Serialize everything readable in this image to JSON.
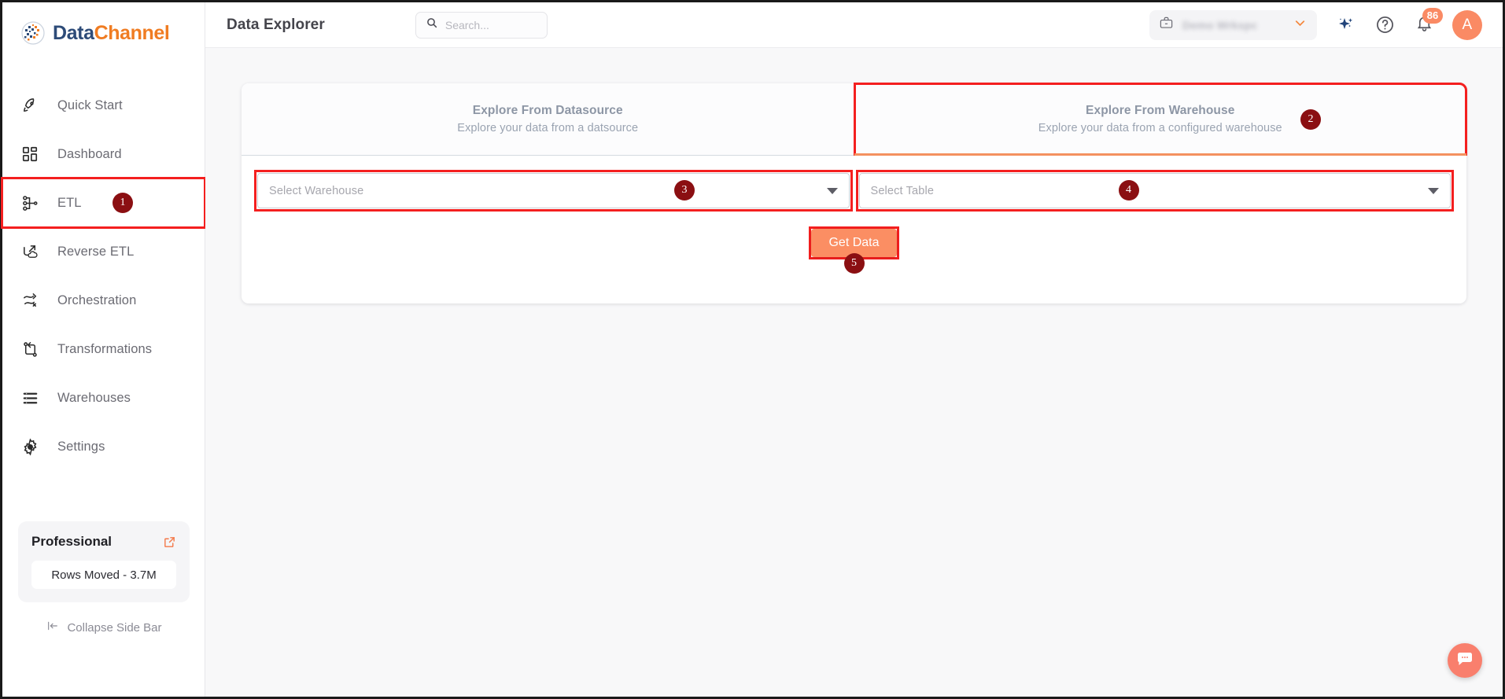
{
  "brand": {
    "name_part1": "Data",
    "name_part2": "Channel",
    "logo_icon": "datachannel-globe-logo",
    "color_primary": "#2d4b78",
    "color_accent": "#f07c22"
  },
  "sidebar": {
    "items": [
      {
        "label": "Quick Start",
        "icon": "rocket-icon"
      },
      {
        "label": "Dashboard",
        "icon": "dashboard-grid-icon"
      },
      {
        "label": "ETL",
        "icon": "etl-nodes-icon"
      },
      {
        "label": "Reverse ETL",
        "icon": "reverse-etl-cloud-icon"
      },
      {
        "label": "Orchestration",
        "icon": "orchestration-path-icon"
      },
      {
        "label": "Transformations",
        "icon": "transformations-branch-icon"
      },
      {
        "label": "Warehouses",
        "icon": "warehouse-stack-icon"
      },
      {
        "label": "Settings",
        "icon": "gear-icon"
      }
    ],
    "plan": {
      "name": "Professional",
      "external_link_icon": "external-link-icon",
      "usage_label": "Rows Moved - 3.7M"
    },
    "collapse": {
      "label": "Collapse Side Bar",
      "icon": "collapse-left-icon"
    }
  },
  "header": {
    "title": "Data Explorer",
    "search": {
      "placeholder": "Search...",
      "value": "",
      "icon": "search-icon"
    },
    "workspace": {
      "icon": "briefcase-icon",
      "name": "Demo Wrkspc",
      "chevron": "chevron-down-icon"
    },
    "ai_icon": "sparkle-ai-icon",
    "help_icon": "help-circle-icon",
    "notifications": {
      "icon": "bell-icon",
      "count": "86",
      "badge_color": "#fa8a64"
    },
    "avatar": {
      "initial": "A",
      "color": "#fa8a64"
    }
  },
  "main": {
    "tabs": [
      {
        "title": "Explore From Datasource",
        "subtitle": "Explore your data from a datsource",
        "active": false
      },
      {
        "title": "Explore From Warehouse",
        "subtitle": "Explore your data from a configured warehouse",
        "active": true
      }
    ],
    "selects": [
      {
        "placeholder": "Select Warehouse",
        "value": "",
        "caret": "caret-down-icon"
      },
      {
        "placeholder": "Select Table",
        "value": "",
        "caret": "caret-down-icon"
      }
    ],
    "get_data_label": "Get Data"
  },
  "annotations": {
    "highlight_color": "#f41f1f",
    "marker_color": "#8b0f12",
    "steps": [
      {
        "number": "1",
        "target": "sidebar-item-etl"
      },
      {
        "number": "2",
        "target": "tab-explore-from-warehouse"
      },
      {
        "number": "3",
        "target": "select-warehouse"
      },
      {
        "number": "4",
        "target": "select-table"
      },
      {
        "number": "5",
        "target": "get-data-button"
      }
    ]
  },
  "chat": {
    "icon": "chat-bubble-icon",
    "color": "#f97f6d"
  }
}
